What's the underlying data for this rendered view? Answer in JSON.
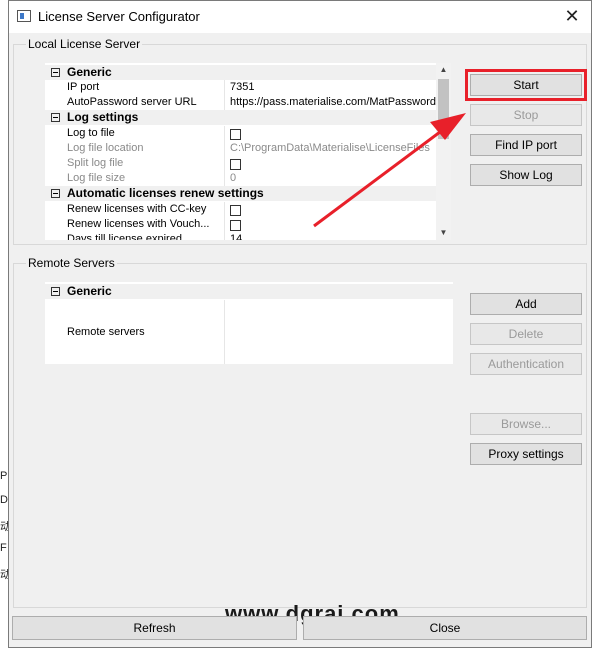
{
  "window": {
    "title": "License Server Configurator"
  },
  "local": {
    "group_title": "Local License Server",
    "sections": [
      {
        "label": "Generic",
        "rows": [
          {
            "name": "IP port",
            "value": "7351",
            "grey": false,
            "checkbox": false
          },
          {
            "name": "AutoPassword server URL",
            "value": "https://pass.materialise.com/MatPasswordsWS/M",
            "grey": false,
            "checkbox": false
          }
        ]
      },
      {
        "label": "Log settings",
        "rows": [
          {
            "name": "Log to file",
            "value": "",
            "grey": false,
            "checkbox": true
          },
          {
            "name": "Log file location",
            "value": "C:\\ProgramData\\Materialise\\LicenseFiles",
            "grey": true,
            "checkbox": false
          },
          {
            "name": "Split log file",
            "value": "",
            "grey": true,
            "checkbox": true
          },
          {
            "name": "Log file size",
            "value": "0",
            "grey": true,
            "checkbox": false
          }
        ]
      },
      {
        "label": "Automatic licenses renew settings",
        "rows": [
          {
            "name": "Renew licenses with CC-key",
            "value": "",
            "grey": false,
            "checkbox": true
          },
          {
            "name": "Renew licenses with Vouch...",
            "value": "",
            "grey": false,
            "checkbox": true
          },
          {
            "name": "Days till license expired",
            "value": "14",
            "grey": false,
            "checkbox": false
          }
        ]
      }
    ],
    "buttons": {
      "start": "Start",
      "stop": "Stop",
      "find_ip": "Find IP port",
      "show_log": "Show Log"
    }
  },
  "remote": {
    "group_title": "Remote Servers",
    "section_label": "Generic",
    "row_name": "Remote servers",
    "buttons": {
      "add": "Add",
      "delete": "Delete",
      "authentication": "Authentication",
      "browse": "Browse...",
      "proxy": "Proxy settings"
    }
  },
  "footer": {
    "refresh": "Refresh",
    "close": "Close"
  },
  "watermark": "www.dgrai.com",
  "background_fragments": [
    "P",
    "D",
    "动",
    "F",
    "动"
  ],
  "colors": {
    "highlight": "#e8202a",
    "arrow": "#e8202a"
  }
}
